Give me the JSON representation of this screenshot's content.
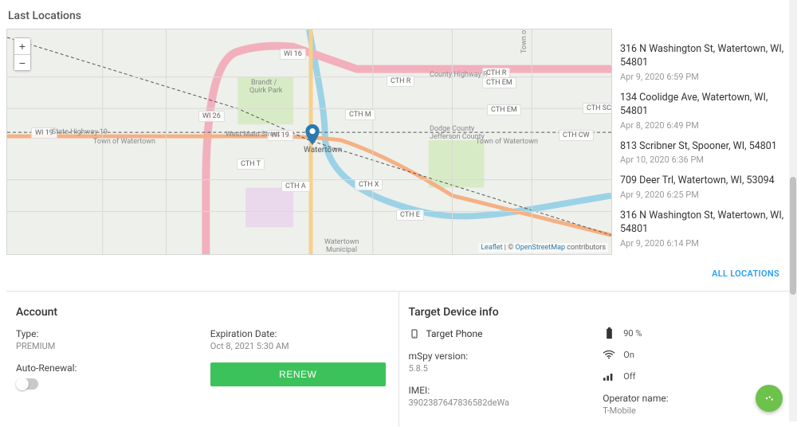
{
  "lastLocations": {
    "title": "Last Locations",
    "zoom_in": "+",
    "zoom_out": "−",
    "attrib_leaflet": "Leaflet",
    "attrib_sep": " | © ",
    "attrib_osm": "OpenStreetMap",
    "attrib_tail": " contributors",
    "marker_label": "Watertown",
    "map_labels": {
      "wi16": "WI 16",
      "wi26": "WI 26",
      "wi19_left": "WI 19",
      "wi19_right": "WI 19",
      "state19": "State Highway 19",
      "town": "Town of Watertown",
      "town2": "Town of Watertown",
      "westmain": "West Main Street",
      "cth_r": "CTH R",
      "cth_r2": "CTH R",
      "cth_em": "CTH EM",
      "cth_em2": "CTH EM",
      "cth_m": "CTH M",
      "cth_sc": "CTH SC",
      "cth_cw": "CTH CW",
      "cth_t": "CTH T",
      "cth_a": "CTH A",
      "cth_x": "CTH X",
      "cth_e": "CTH E",
      "county_hwy_r": "County Highway R",
      "dodge": "Dodge County",
      "jefferson": "Jefferson County",
      "brandt": "Brandt /",
      "brandt2": "Quirk Park",
      "emmet": "Town of Emmet",
      "watertown_muni": "Watertown",
      "watertown_muni2": "Municipal"
    },
    "items": [
      {
        "address": "316 N Washington St, Watertown, WI, 54801",
        "ts": "Apr 9, 2020 6:59 PM"
      },
      {
        "address": "134 Coolidge Ave, Watertown, WI, 54801",
        "ts": "Apr 8, 2020 6:49 PM"
      },
      {
        "address": "813 Scribner St, Spooner, WI, 54801",
        "ts": "Apr 10, 2020 6:36 PM"
      },
      {
        "address": "709 Deer Trl, Watertown, WI, 53094",
        "ts": "Apr 9, 2020 6:25 PM"
      },
      {
        "address": "316 N Washington St, Watertown, WI, 54801",
        "ts": "Apr 9, 2020 6:14 PM"
      }
    ],
    "all_link": "ALL LOCATIONS"
  },
  "account": {
    "title": "Account",
    "type_label": "Type:",
    "type_value": "PREMIUM",
    "auto_label": "Auto-Renewal:",
    "exp_label": "Expiration Date:",
    "exp_value": "Oct 8, 2021 5:30 AM",
    "renew": "RENEW"
  },
  "device": {
    "title": "Target Device info",
    "phone_label": "Target Phone",
    "mspy_label": "mSpy version:",
    "mspy_value": "5.8.5",
    "imei_label": "IMEI:",
    "imei_value": "3902387647836582deWa",
    "batt": "90 %",
    "wifi": "On",
    "cell": "Off",
    "op_label": "Operator name:",
    "op_value": "T-Mobile"
  }
}
